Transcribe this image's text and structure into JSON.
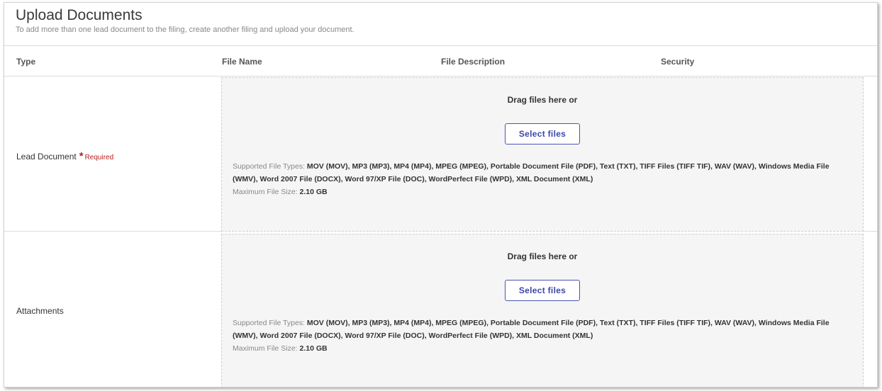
{
  "header": {
    "title": "Upload Documents",
    "subtitle": "To add more than one lead document to the filing, create another filing and upload your document."
  },
  "columns": {
    "type": "Type",
    "file_name": "File Name",
    "file_description": "File Description",
    "security": "Security"
  },
  "rows": [
    {
      "type_label": "Lead Document",
      "required_star": "*",
      "required_text": "Required",
      "drag_text": "Drag files here or",
      "select_label": "Select files",
      "supported_label": "Supported File Types:",
      "supported_types": "MOV (MOV), MP3 (MP3), MP4 (MP4), MPEG (MPEG), Portable Document File (PDF), Text (TXT), TIFF Files (TIFF TIF), WAV (WAV), Windows Media File (WMV), Word 2007 File (DOCX), Word 97/XP File (DOC), WordPerfect File (WPD), XML Document (XML)",
      "max_size_label": "Maximum File Size:",
      "max_size": "2.10 GB"
    },
    {
      "type_label": "Attachments",
      "drag_text": "Drag files here or",
      "select_label": "Select files",
      "supported_label": "Supported File Types:",
      "supported_types": "MOV (MOV), MP3 (MP3), MP4 (MP4), MPEG (MPEG), Portable Document File (PDF), Text (TXT), TIFF Files (TIFF TIF), WAV (WAV), Windows Media File (WMV), Word 2007 File (DOCX), Word 97/XP File (DOC), WordPerfect File (WPD), XML Document (XML)",
      "max_size_label": "Maximum File Size:",
      "max_size": "2.10 GB"
    }
  ],
  "colors": {
    "accent": "#4a55b5",
    "required": "#b22222"
  }
}
